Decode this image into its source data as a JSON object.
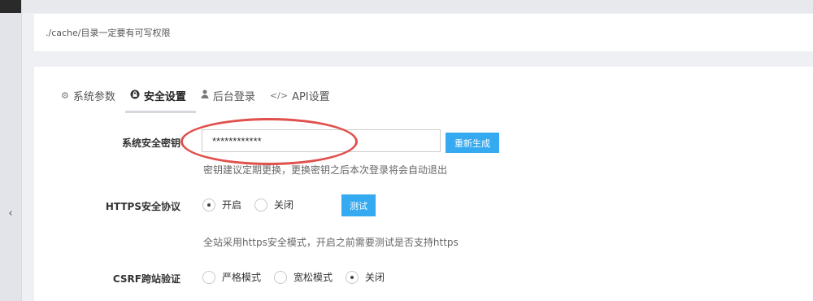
{
  "path_notice": {
    "path": "./cache/",
    "note": "目录一定要有可写权限"
  },
  "tabs": [
    {
      "label": "系统参数",
      "icon": "gear-icon",
      "active": false
    },
    {
      "label": "安全设置",
      "icon": "lock-icon",
      "active": true
    },
    {
      "label": "后台登录",
      "icon": "user-icon",
      "active": false
    },
    {
      "label": "API设置",
      "icon": "code-icon",
      "active": false
    }
  ],
  "security_key": {
    "label": "系统安全密钥",
    "value": "************",
    "regenerate_label": "重新生成",
    "hint": "密钥建议定期更换，更换密钥之后本次登录将会自动退出"
  },
  "https": {
    "label": "HTTPS安全协议",
    "options": [
      "开启",
      "关闭"
    ],
    "selected": "开启",
    "test_label": "测试",
    "hint": "全站采用https安全模式，开启之前需要测试是否支持https"
  },
  "csrf": {
    "label": "CSRF跨站验证",
    "options": [
      "严格模式",
      "宽松模式",
      "关闭"
    ],
    "selected": "关闭"
  },
  "colors": {
    "accent": "#35aaf0",
    "highlight_ellipse": "#e0504c"
  }
}
